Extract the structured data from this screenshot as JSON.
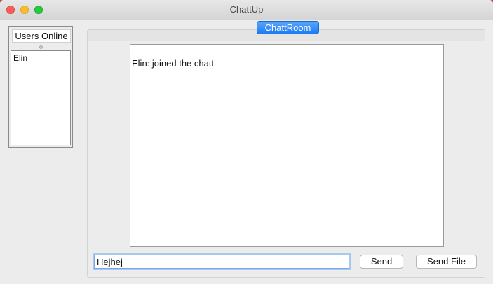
{
  "window": {
    "title": "ChattUp"
  },
  "users_panel": {
    "header": "Users Online",
    "users": [
      "Elin"
    ]
  },
  "chat": {
    "tab_label": "ChattRoom",
    "messages": [
      "Elin: joined the chatt"
    ]
  },
  "composer": {
    "input_value": "Hejhej",
    "send_label": "Send",
    "send_file_label": "Send File"
  },
  "colors": {
    "tab_accent": "#1c7cf4",
    "input_focus_ring": "#a7c8f3"
  }
}
